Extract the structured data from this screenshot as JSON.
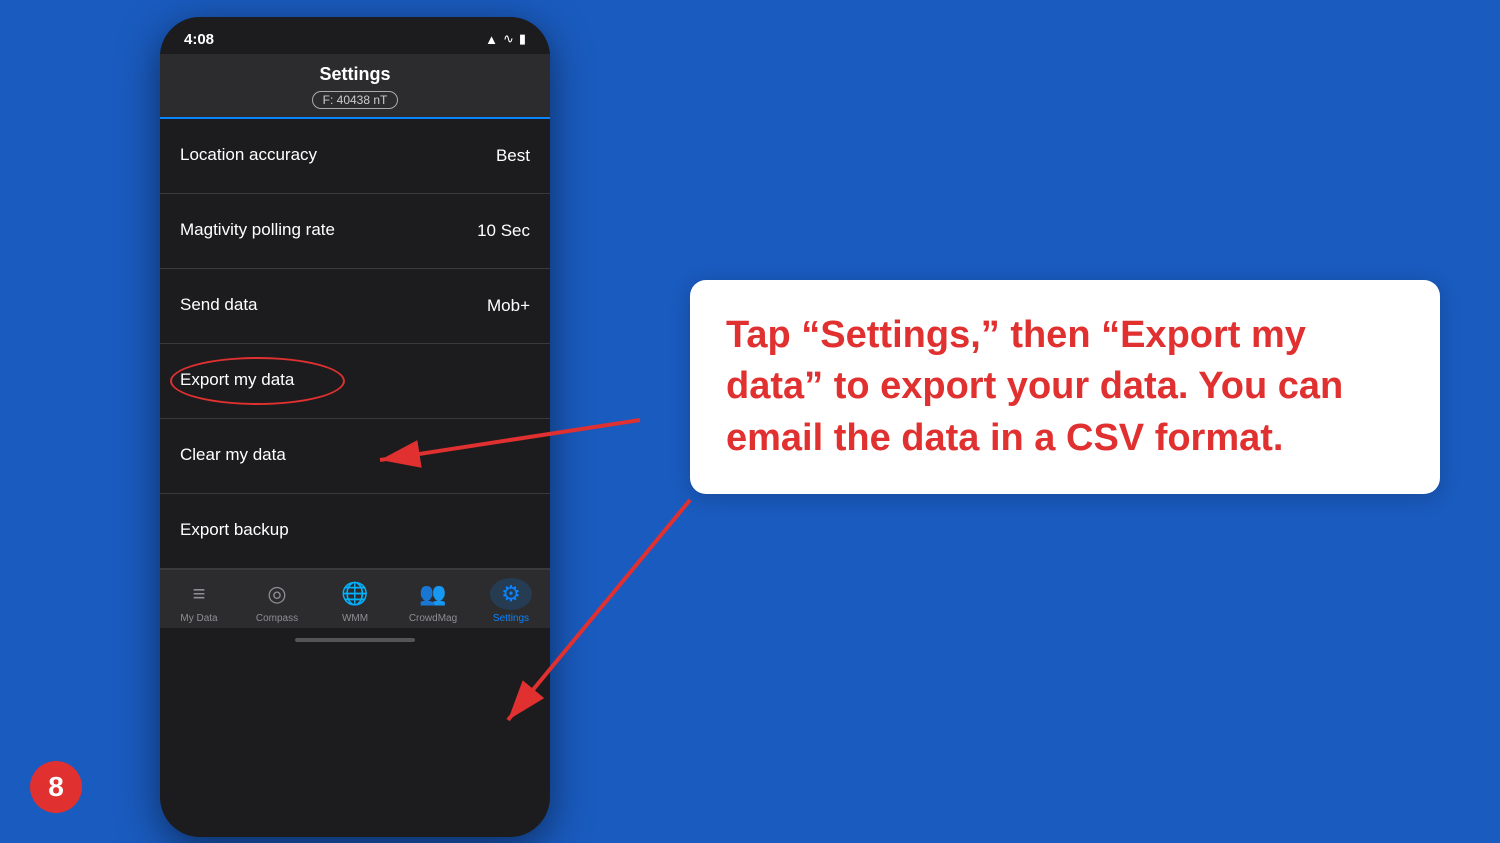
{
  "page": {
    "background_color": "#1a5bbf"
  },
  "status_bar": {
    "time": "4:08",
    "signal_icon": "▲",
    "wifi_icon": "wifi",
    "battery_icon": "battery"
  },
  "header": {
    "title": "Settings",
    "subtitle": "F: 40438 nT"
  },
  "settings_rows": [
    {
      "label": "Location accuracy",
      "value": "Best"
    },
    {
      "label": "Magtivity polling rate",
      "value": "10 Sec"
    },
    {
      "label": "Send data",
      "value": "Mob+"
    },
    {
      "label": "Export my data",
      "value": ""
    },
    {
      "label": "Clear my data",
      "value": ""
    },
    {
      "label": "Export backup",
      "value": ""
    }
  ],
  "tabs": [
    {
      "id": "my-data",
      "label": "My Data",
      "icon": "≡",
      "active": false
    },
    {
      "id": "compass",
      "label": "Compass",
      "icon": "◎",
      "active": false
    },
    {
      "id": "wmm",
      "label": "WMM",
      "icon": "🌐",
      "active": false
    },
    {
      "id": "crowdmag",
      "label": "CrowdMag",
      "icon": "👥",
      "active": false
    },
    {
      "id": "settings",
      "label": "Settings",
      "icon": "⚙",
      "active": true
    }
  ],
  "badge": {
    "number": "8"
  },
  "callout": {
    "text": "Tap “Settings,” then “Export my data” to export your data. You can email the data in a CSV format."
  }
}
